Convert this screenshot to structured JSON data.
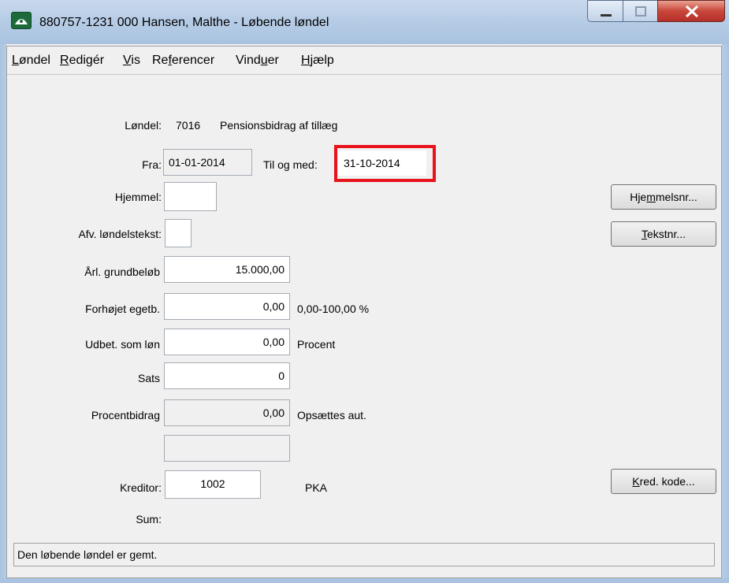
{
  "window": {
    "title": "880757-1231 000 Hansen, Malthe - Løbende løndel"
  },
  "menu": [
    {
      "pre": "",
      "u": "L",
      "post": "øndel"
    },
    {
      "pre": "",
      "u": "R",
      "post": "edigér"
    },
    {
      "pre": "",
      "u": "V",
      "post": "is"
    },
    {
      "pre": "Re",
      "u": "f",
      "post": "erencer"
    },
    {
      "pre": "Vind",
      "u": "u",
      "post": "er"
    },
    {
      "pre": "",
      "u": "H",
      "post": "jælp"
    }
  ],
  "form": {
    "loendel_label": "Løndel:",
    "loendel_code": "7016",
    "loendel_name": "Pensionsbidrag af tillæg",
    "fra_label": "Fra:",
    "fra_value": "01-01-2014",
    "til_label": "Til og med:",
    "til_value": "31-10-2014",
    "hjemmel_label": "Hjemmel:",
    "hjemmel_value": "",
    "afv_label": "Afv. løndelstekst:",
    "afv_value": "",
    "aarl_label": "Årl. grundbeløb",
    "aarl_value": "15.000,00",
    "forhoejet_label": "Forhøjet egetb.",
    "forhoejet_value": "0,00",
    "forhoejet_hint": "0,00-100,00 %",
    "udbet_label": "Udbet. som løn",
    "udbet_value": "0,00",
    "udbet_hint": "Procent",
    "sats_label": "Sats",
    "sats_value": "0",
    "procent_label": "Procentbidrag",
    "procent_value": "0,00",
    "procent_hint": "Opsættes aut.",
    "extra_value": "",
    "kreditor_label": "Kreditor:",
    "kreditor_value": "1002",
    "kreditor_name": "PKA",
    "sum_label": "Sum:"
  },
  "buttons": {
    "hjemmelsnr": {
      "pre": "Hje",
      "u": "m",
      "post": "melsnr..."
    },
    "tekstnr": {
      "pre": "",
      "u": "T",
      "post": "ekstnr..."
    },
    "kred": {
      "pre": "",
      "u": "K",
      "post": "red. kode..."
    }
  },
  "status": {
    "text": "Den løbende løndel er gemt."
  },
  "colors": {
    "highlight": "#e8131b"
  }
}
